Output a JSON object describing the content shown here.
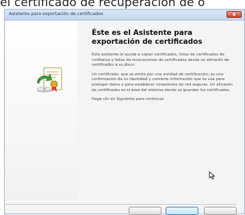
{
  "caption": "el certificado de recuperación de o",
  "dialog": {
    "title": "Asistente para exportación de certificados",
    "close_glyph": "x"
  },
  "content": {
    "heading": "Éste es el Asistente para exportación de certificados",
    "paragraphs": [
      "Este asistente le ayuda a copiar certificados, listas de certificados de confianza y listas de revocaciones de certificados desde un almacén de certificados a su disco.",
      "Un certificado, que se emite por una entidad de certificación, es una confirmación de su identidad y contiene información que se usa para proteger datos o para establecer conexiones de red seguras. Un almacén de certificados es el área del sistema donde se guardan los certificados.",
      "Haga clic en Siguiente para continuar."
    ]
  },
  "buttons": {
    "back_label": "",
    "next_label": "",
    "cancel_label": ""
  },
  "icons": {
    "wizard": "certificate-export-icon",
    "cursor": "mouse-cursor-icon"
  }
}
